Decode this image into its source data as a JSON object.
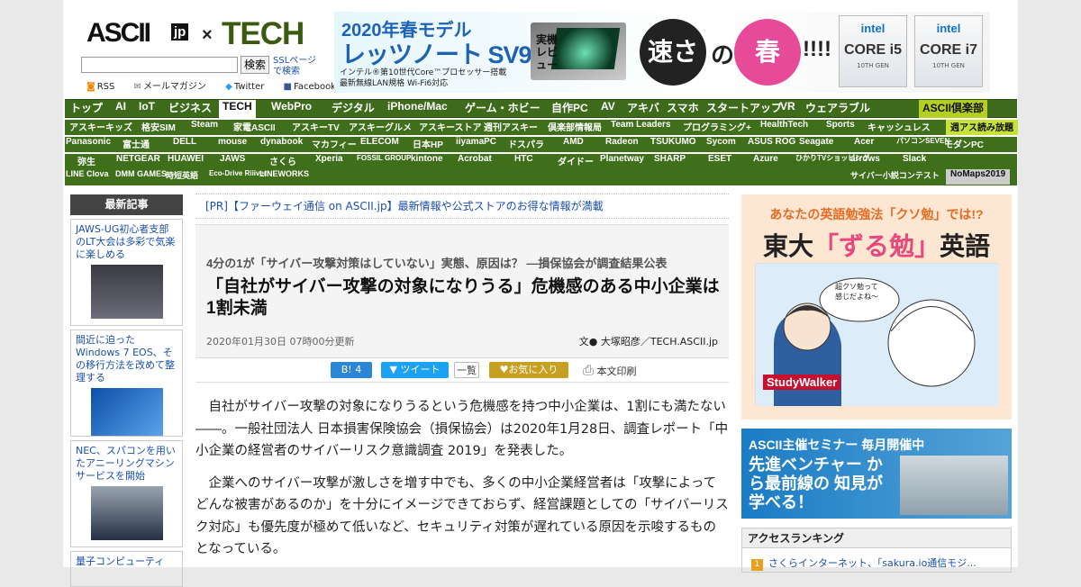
{
  "header": {
    "logo_ascii": "ASCII",
    "logo_jp": "jp",
    "logo_x": "×",
    "logo_tech": "TECH",
    "search_placeholder": "",
    "search_button": "検索",
    "ssl_link": "SSLページ で検索",
    "links": [
      "RSS",
      "メールマガジン",
      "Twitter",
      "Facebook"
    ]
  },
  "banner": {
    "line1": "2020年春モデル",
    "line2": "レッツノート SV9",
    "review": "実機 レビュー",
    "desc1": "インテル®第10世代Core™プロセッサー搭載",
    "desc2": "最新無線LAN規格 Wi-Fi6対応",
    "c1": "速さ",
    "no": "の",
    "c2": "春",
    "ex": "!!!!",
    "chips": [
      {
        "brand": "intel",
        "core": "CORE i5",
        "gen": "10TH GEN"
      },
      {
        "brand": "intel",
        "core": "CORE i7",
        "gen": "10TH GEN"
      }
    ]
  },
  "nav_main": [
    "トップ",
    "AI",
    "IoT",
    "ビジネス",
    "TECH",
    "WebPro",
    "デジタル",
    "iPhone/Mac",
    "ゲーム・ホビー",
    "自作PC",
    "AV",
    "アキバ",
    "スマホ",
    "スタートアップ",
    "VR",
    "ウェアラブル",
    "ASCII倶楽部"
  ],
  "nav_row2": [
    "アスキーキッズ",
    "格安SIM",
    "Steam",
    "家電ASCII",
    "アスキーTV",
    "アスキーグルメ",
    "アスキーストア",
    "週刊アスキー",
    "倶楽部情報局",
    "Team Leaders",
    "プログラミング+",
    "HealthTech",
    "Sports",
    "キャッシュレス",
    "週アス読み放題"
  ],
  "nav_row3": [
    "Panasonic",
    "富士通",
    "DELL",
    "mouse",
    "dynabook",
    "マカフィー",
    "ELECOM",
    "日本HP",
    "iiyamaPC",
    "ドスパラ",
    "AMD",
    "Radeon",
    "TSUKUMO",
    "Sycom",
    "ASUS ROG",
    "Seagate",
    "Acer",
    "パソコンSEVEN",
    "モダンPC"
  ],
  "nav_row4": [
    "弥生",
    "NETGEAR",
    "HUAWEI",
    "JAWS",
    "さくら",
    "Xperia",
    "FOSSIL GROUP",
    "kintone",
    "Acrobat",
    "HTC",
    "ダイドー",
    "Planetway",
    "SHARP",
    "ESET",
    "Azure",
    "ひかりTVショッピング",
    "arrows",
    "Slack"
  ],
  "nav_row5": [
    "LINE Clova",
    "DMM GAMES",
    "時短英語",
    "Eco-Drive Riiiver",
    "LINEWORKS",
    "サイバー小説コンテスト",
    "NoMaps2019"
  ],
  "sidebar": {
    "heading": "最新記事",
    "items": [
      "JAWS-UG初心者支部のLT大会は多彩で気楽に楽しめる",
      "間近に迫ったWindows 7 EOS、その移行方法を改めて整理する",
      "NEC、スパコンを用いたアニーリングマシンサービスを開始",
      "量子コンピューティ"
    ]
  },
  "pr": "[PR]【ファーウェイ通信 on ASCII.jp】最新情報や公式ストアのお得な情報が満載",
  "article": {
    "subtitle": "4分の1が「サイバー攻撃対策はしていない」実態、原因は？ —損保協会が調査結果公表",
    "title": "「自社がサイバー攻撃の対象になりうる」危機感のある中小企業は1割未満",
    "date": "2020年01月30日 07時00分更新",
    "author": "文● 大塚昭彦／TECH.ASCII.jp",
    "paragraphs": [
      "自社がサイバー攻撃の対象になりうるという危機感を持つ中小企業は、1割にも満たない――。一般社団法人 日本損害保険協会（損保協会）は2020年1月28日、調査レポート「中小企業の経営者のサイバーリスク意識調査 2019」を発表した。",
      "企業へのサイバー攻撃が激しさを増す中でも、多くの中小企業経営者は「攻撃によってどんな被害があるのか」を十分にイメージできておらず、経営課題としての「サイバーリスク対応」も優先度が極めて低いなど、セキュリティ対策が遅れている原因を示唆するものとなっている。"
    ]
  },
  "share": {
    "hatena": "B! 4",
    "tweet": "ツイート",
    "list": "一覧",
    "fav": "お気に入り",
    "print": "本文印刷"
  },
  "ad1": {
    "top": "あなたの英語勉強法「クソ勉」では!?",
    "main1": "東大",
    "main2": "「ずる勉」",
    "main3": "英語",
    "bubble": "超クソ勉って 感じだよね〜",
    "brand": "StudyWalker"
  },
  "ad2": {
    "head": "ASCII主催セミナー 毎月開催中",
    "text": "先進ベンチャー から最前線の 知見が学べる！"
  },
  "ranking": {
    "heading": "アクセスランキング",
    "first_num": "1",
    "first": "さくらインターネット、「sakura.io通信モジ..."
  },
  "colors": {
    "nav_green": "#3d6a1b",
    "tech_green": "#3b5a10",
    "link_blue": "#1a4fae",
    "club_yellow": "#b4cf1f"
  }
}
